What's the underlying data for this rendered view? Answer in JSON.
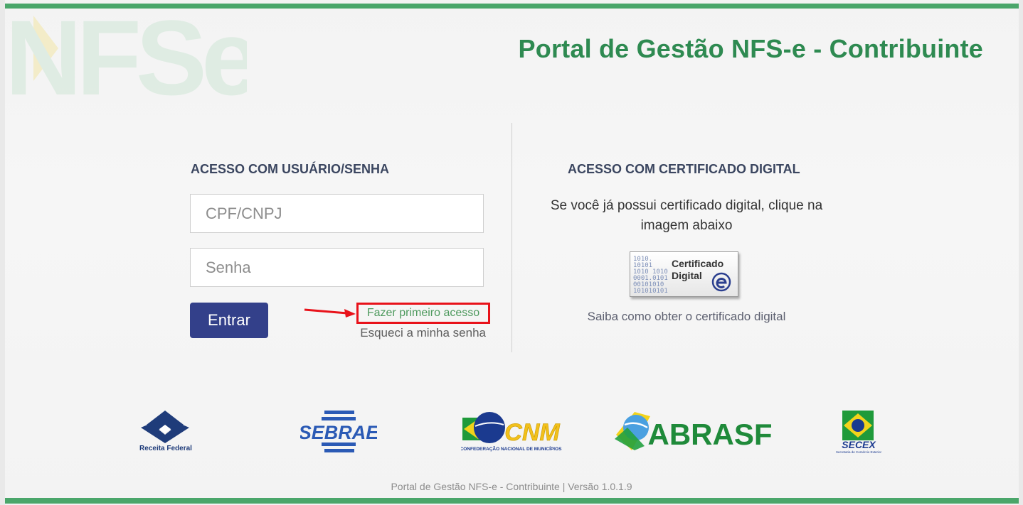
{
  "header": {
    "title": "Portal de Gestão NFS-e - Contribuinte",
    "logo_letters": "NFSe"
  },
  "login": {
    "title": "ACESSO COM USUÁRIO/SENHA",
    "cpf_placeholder": "CPF/CNPJ",
    "password_placeholder": "Senha",
    "submit_label": "Entrar",
    "first_access_label": "Fazer primeiro acesso",
    "forgot_label": "Esqueci a minha senha"
  },
  "certificate": {
    "title": "ACESSO COM CERTIFICADO DIGITAL",
    "instruction": "Se você já possui certificado digital, clique na imagem abaixo",
    "badge_line1": "Certificado",
    "badge_line2": "Digital",
    "help_link": "Saiba como obter o certificado digital"
  },
  "partners": {
    "receita": "Receita Federal",
    "sebrae": "SEBRAE",
    "cnm": "CNM",
    "cnm_sub": "CONFEDERAÇÃO NACIONAL DE MUNICÍPIOS",
    "abrasf": "ABRASF",
    "secex": "SECEX",
    "secex_sub": "Secretaria de Comércio Exterior"
  },
  "footer": {
    "text": "Portal de Gestão NFS-e - Contribuinte | Versão 1.0.1.9"
  },
  "colors": {
    "brand_green": "#2e8a51",
    "button_blue": "#33408a",
    "highlight_red": "#e8121a"
  }
}
